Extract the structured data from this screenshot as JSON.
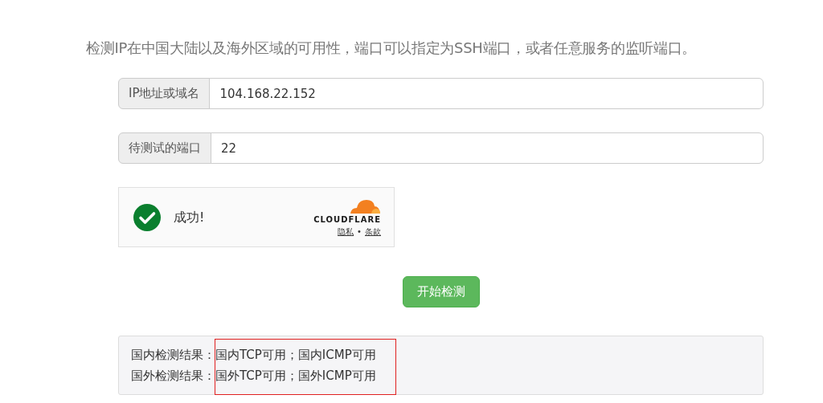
{
  "description": "检测IP在中国大陆以及海外区域的可用性，端口可以指定为SSH端口，或者任意服务的监听端口。",
  "fields": [
    {
      "label": "IP地址或域名",
      "value": "104.168.22.152"
    },
    {
      "label": "待测试的端口",
      "value": "22"
    }
  ],
  "captcha": {
    "checked": true,
    "status": "成功!",
    "brand": "CLOUDFLARE",
    "links": [
      "隐私",
      "条款"
    ],
    "separator": "•"
  },
  "submit_button": "开始检测",
  "results": {
    "highlighted": true,
    "rows": [
      {
        "label": "国内检测结果：",
        "value": "国内TCP可用；国内ICMP可用"
      },
      {
        "label": "国外检测结果：",
        "value": "国外TCP可用；国外ICMP可用"
      }
    ]
  }
}
